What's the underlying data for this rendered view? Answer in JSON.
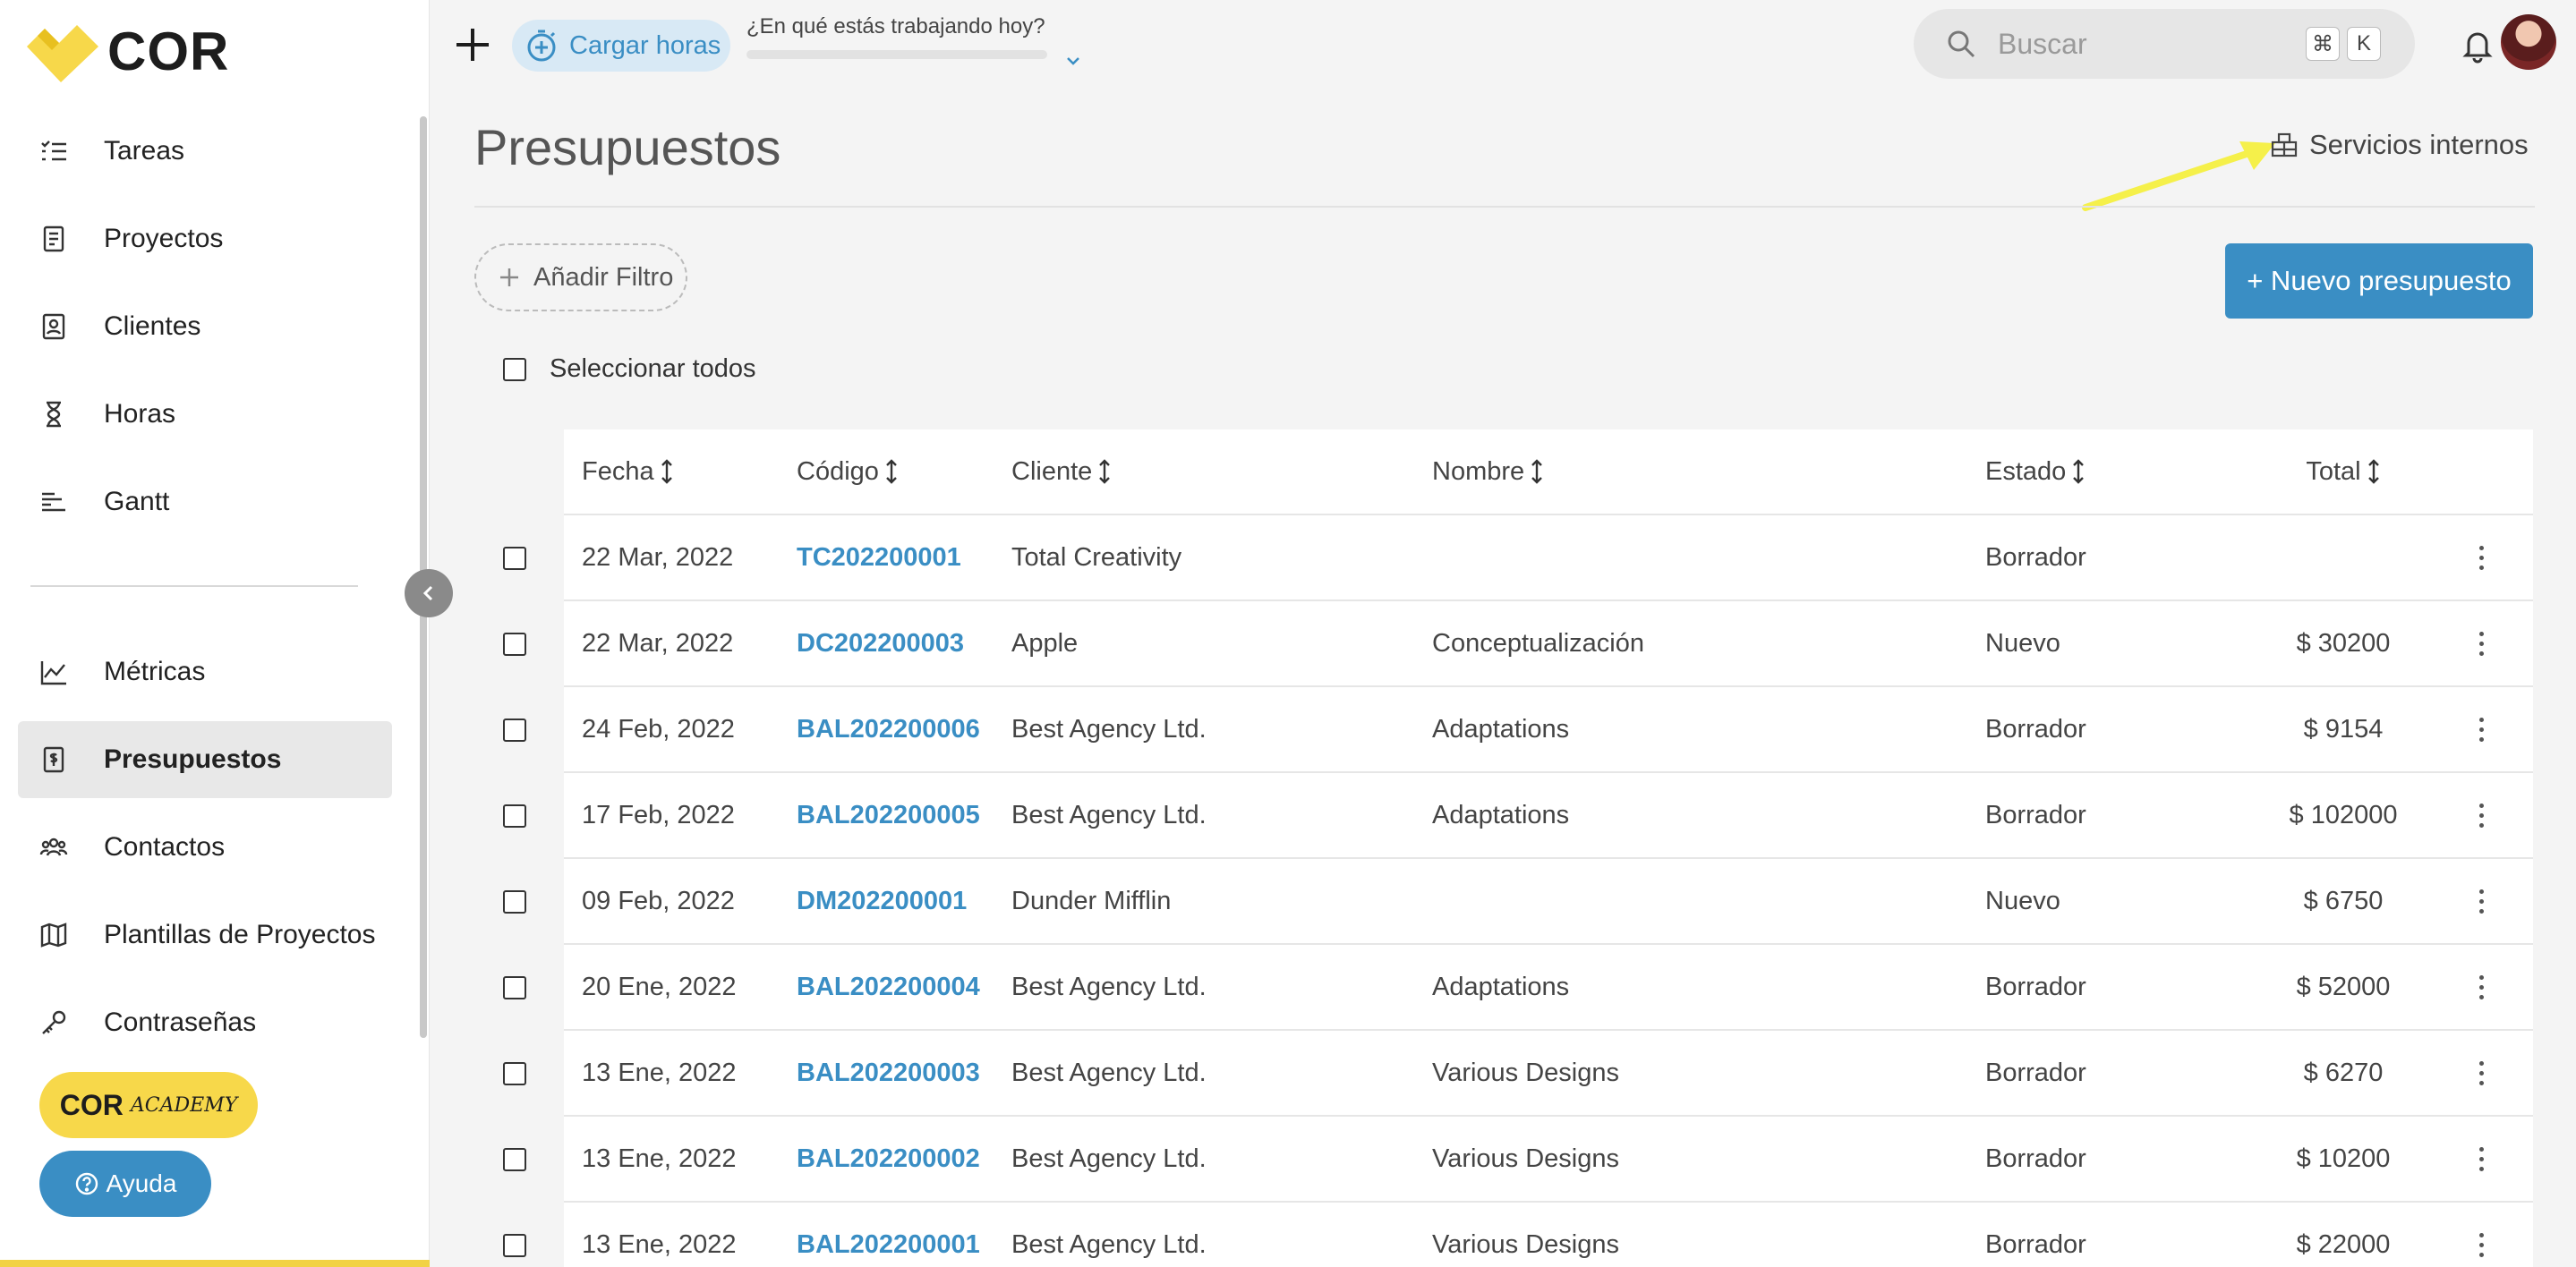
{
  "app": {
    "logo_text": "COR"
  },
  "sidebar": {
    "items": [
      {
        "label": "Tareas",
        "icon": "tasks-list-icon"
      },
      {
        "label": "Proyectos",
        "icon": "project-doc-icon"
      },
      {
        "label": "Clientes",
        "icon": "client-card-icon"
      },
      {
        "label": "Horas",
        "icon": "hourglass-icon"
      },
      {
        "label": "Gantt",
        "icon": "gantt-icon"
      }
    ],
    "items2": [
      {
        "label": "Métricas",
        "icon": "chart-icon"
      },
      {
        "label": "Presupuestos",
        "icon": "budget-doc-icon",
        "active": true
      },
      {
        "label": "Contactos",
        "icon": "contacts-icon"
      },
      {
        "label": "Plantillas de Proyectos",
        "icon": "map-icon"
      },
      {
        "label": "Contraseñas",
        "icon": "key-icon"
      }
    ],
    "academy_label": "COR",
    "academy_sub": "ACADEMY",
    "help_label": "Ayuda"
  },
  "topbar": {
    "timer_label": "Cargar horas",
    "working_question": "¿En qué estás trabajando hoy?",
    "search_placeholder": "Buscar",
    "kbd1": "⌘",
    "kbd2": "K"
  },
  "main": {
    "title": "Presupuestos",
    "internal_services": "Servicios internos",
    "add_filter": "Añadir Filtro",
    "new_budget": "+ Nuevo presupuesto",
    "select_all": "Seleccionar todos"
  },
  "table": {
    "headers": {
      "fecha": "Fecha",
      "codigo": "Código",
      "cliente": "Cliente",
      "nombre": "Nombre",
      "estado": "Estado",
      "total": "Total"
    },
    "rows": [
      {
        "fecha": "22 Mar, 2022",
        "codigo": "TC202200001",
        "cliente": "Total Creativity",
        "nombre": "",
        "estado": "Borrador",
        "total": ""
      },
      {
        "fecha": "22 Mar, 2022",
        "codigo": "DC202200003",
        "cliente": "Apple",
        "nombre": "Conceptualización",
        "estado": "Nuevo",
        "total": "$ 30200"
      },
      {
        "fecha": "24 Feb, 2022",
        "codigo": "BAL202200006",
        "cliente": "Best Agency Ltd.",
        "nombre": "Adaptations",
        "estado": "Borrador",
        "total": "$ 9154"
      },
      {
        "fecha": "17 Feb, 2022",
        "codigo": "BAL202200005",
        "cliente": "Best Agency Ltd.",
        "nombre": "Adaptations",
        "estado": "Borrador",
        "total": "$ 102000"
      },
      {
        "fecha": "09 Feb, 2022",
        "codigo": "DM202200001",
        "cliente": "Dunder Mifflin",
        "nombre": "",
        "estado": "Nuevo",
        "total": "$ 6750"
      },
      {
        "fecha": "20 Ene, 2022",
        "codigo": "BAL202200004",
        "cliente": "Best Agency Ltd.",
        "nombre": "Adaptations",
        "estado": "Borrador",
        "total": "$ 52000"
      },
      {
        "fecha": "13 Ene, 2022",
        "codigo": "BAL202200003",
        "cliente": "Best Agency Ltd.",
        "nombre": "Various Designs",
        "estado": "Borrador",
        "total": "$ 6270"
      },
      {
        "fecha": "13 Ene, 2022",
        "codigo": "BAL202200002",
        "cliente": "Best Agency Ltd.",
        "nombre": "Various Designs",
        "estado": "Borrador",
        "total": "$ 10200"
      },
      {
        "fecha": "13 Ene, 2022",
        "codigo": "BAL202200001",
        "cliente": "Best Agency Ltd.",
        "nombre": "Various Designs",
        "estado": "Borrador",
        "total": "$ 22000"
      }
    ]
  },
  "colors": {
    "accent": "#3a8ec4",
    "brand_yellow": "#f7d84a",
    "annotation_arrow": "#f5f04a"
  }
}
